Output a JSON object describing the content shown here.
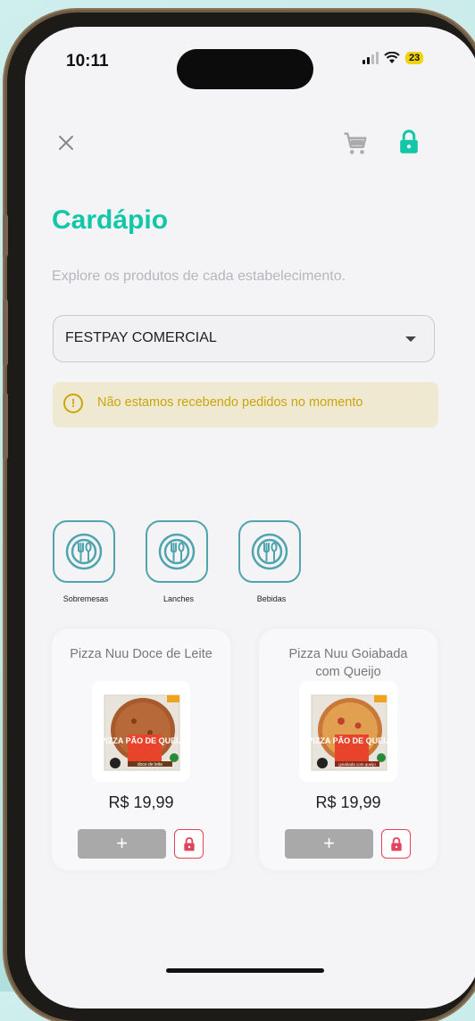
{
  "status": {
    "time": "10:11",
    "battery": "23"
  },
  "page": {
    "title": "Cardápio",
    "subtitle": "Explore os produtos de cada estabelecimento."
  },
  "establishment_select": {
    "value": "FESTPAY COMERCIAL"
  },
  "alert": {
    "text": "Não estamos recebendo pedidos no momento"
  },
  "categories": [
    {
      "label": "Sobremesas",
      "icon": "utensils-icon"
    },
    {
      "label": "Lanches",
      "icon": "utensils-icon"
    },
    {
      "label": "Bebidas",
      "icon": "utensils-icon"
    }
  ],
  "products": [
    {
      "name": "Pizza Nuu Doce de Leite",
      "price": "R$ 19,99",
      "add_label": "+",
      "package_text": "PIZZA PÃO DE QUEIJO",
      "variant": "doce de leite"
    },
    {
      "name": "Pizza Nuu Goiabada com Queijo",
      "price": "R$ 19,99",
      "add_label": "+",
      "package_text": "PIZZA PÃO DE QUEIJO",
      "variant": "goiabada com queijo"
    }
  ],
  "colors": {
    "accent": "#13c6a7",
    "warning": "#c9a50a",
    "lock": "#e0435a"
  }
}
